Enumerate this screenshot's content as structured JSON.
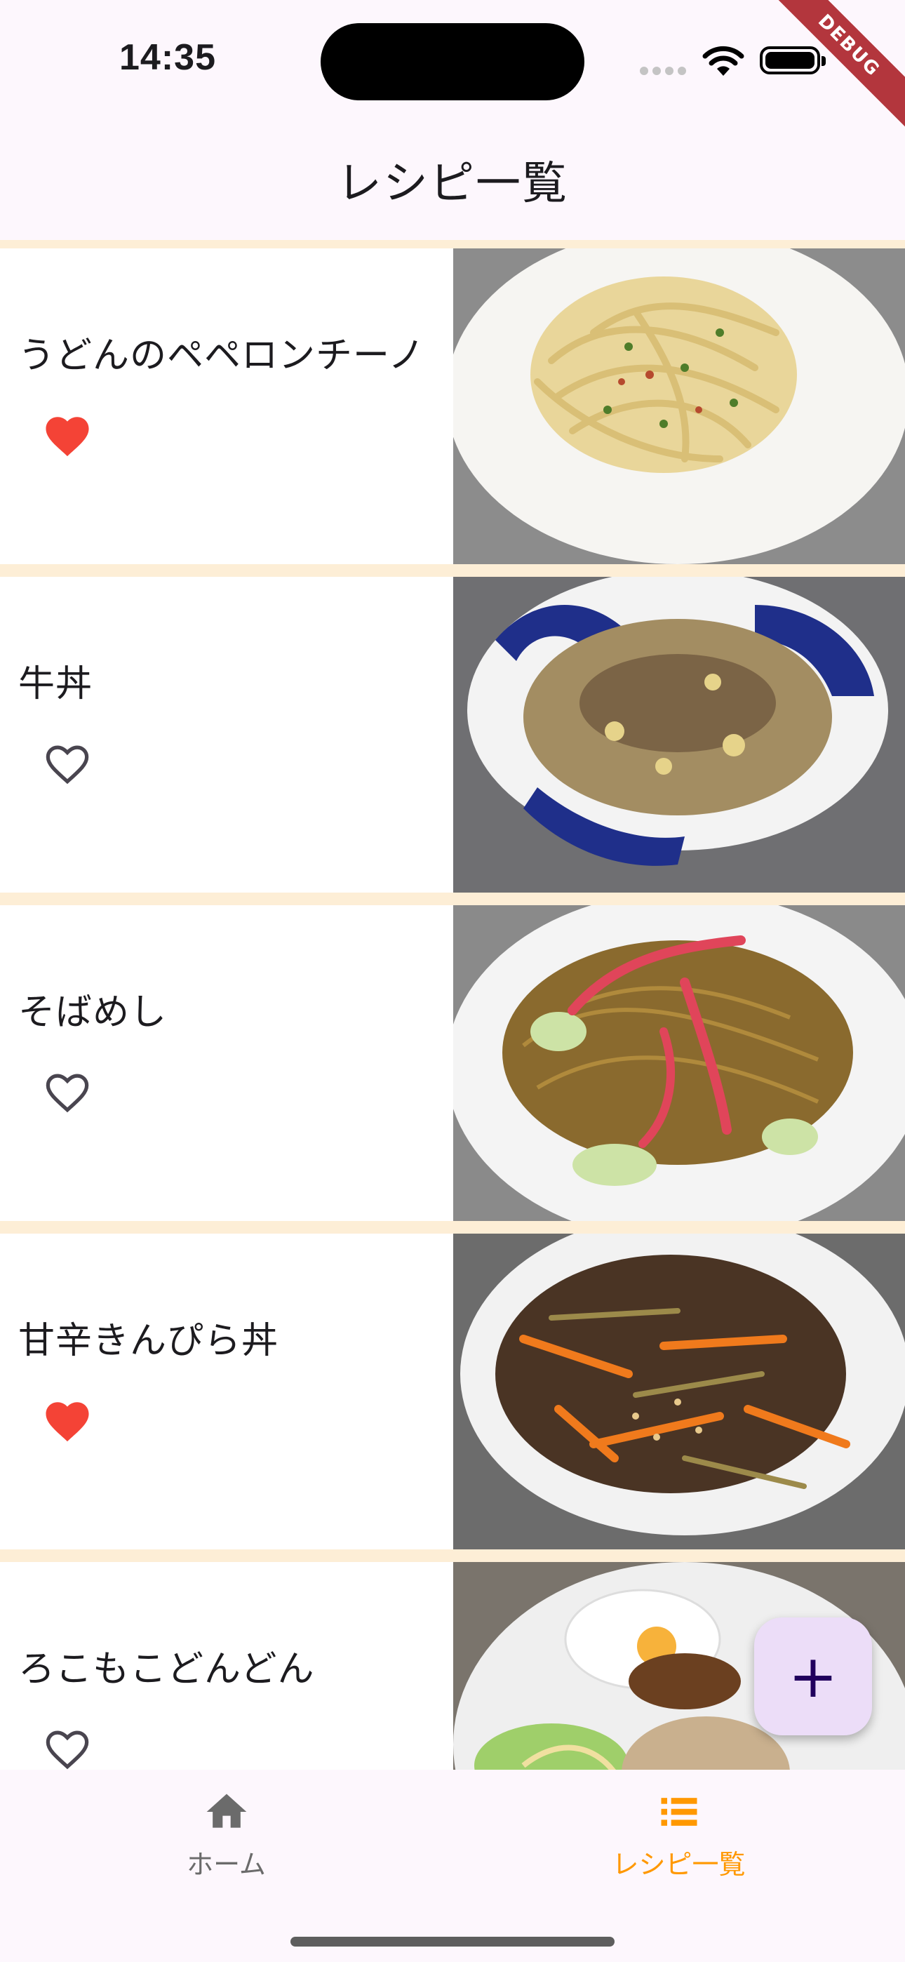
{
  "status_bar": {
    "time": "14:35"
  },
  "debug_banner": "DEBUG",
  "app_bar": {
    "title": "レシピ一覧"
  },
  "recipes": [
    {
      "title": "うどんのペペロンチーノ",
      "favorite": true
    },
    {
      "title": "牛丼",
      "favorite": false
    },
    {
      "title": "そばめし",
      "favorite": false
    },
    {
      "title": "甘辛きんぴら丼",
      "favorite": true
    },
    {
      "title": "ろこもこどんどん",
      "favorite": false
    }
  ],
  "fab": {
    "icon": "plus-icon",
    "label": "+"
  },
  "bottom_nav": {
    "items": [
      {
        "label": "ホーム",
        "icon": "home-icon",
        "selected": false
      },
      {
        "label": "レシピ一覧",
        "icon": "list-icon",
        "selected": true
      }
    ]
  },
  "colors": {
    "background": "#fdf7fd",
    "divider": "#fdeed6",
    "favorite": "#f44336",
    "accent": "#ff9800",
    "nav_inactive": "#6b6b6b",
    "fab": "#ecddf8"
  }
}
